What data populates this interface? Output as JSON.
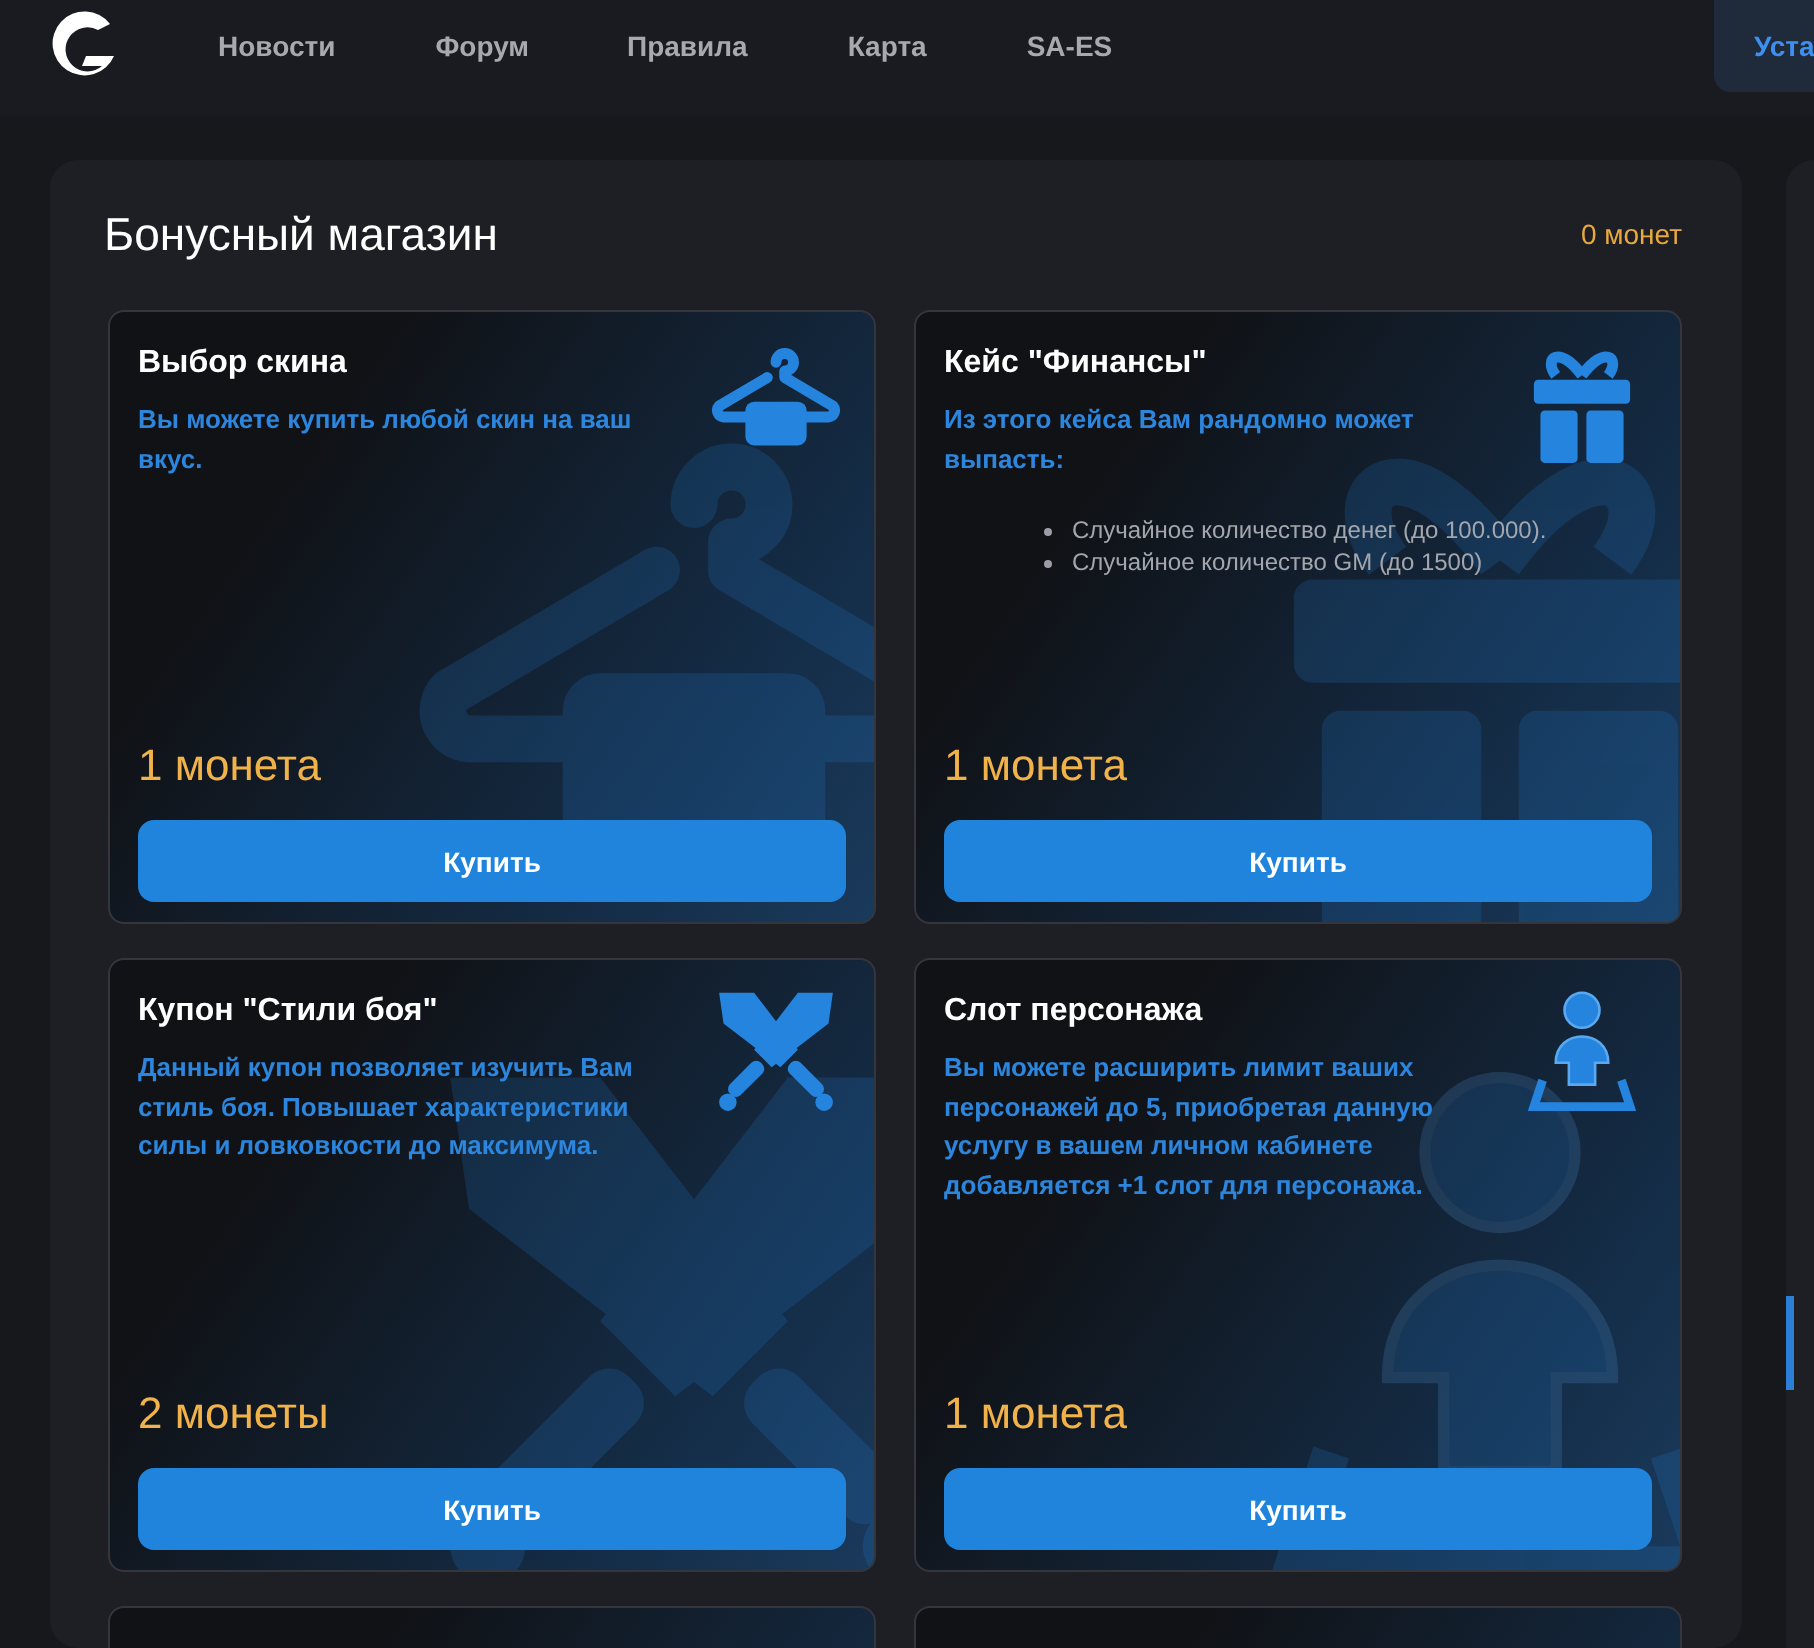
{
  "header": {
    "nav": [
      {
        "label": "Новости"
      },
      {
        "label": "Форум"
      },
      {
        "label": "Правила"
      },
      {
        "label": "Карта"
      },
      {
        "label": "SA-ES"
      }
    ],
    "action_button": "Уста"
  },
  "shop": {
    "title": "Бонусный магазин",
    "balance": "0 монет",
    "cards": [
      {
        "kind": "hanger",
        "title": "Выбор скина",
        "description": "Вы можете купить любой скин на ваш вкус.",
        "price": "1 монета",
        "button": "Купить"
      },
      {
        "kind": "gift",
        "title": "Кейс \"Финансы\"",
        "description": "Из этого кейса Вам рандомно может выпасть:",
        "bullets": [
          "Случайное количество денег (до 100.000).",
          "Случайное количество GM (до 1500)"
        ],
        "price": "1 монета",
        "button": "Купить"
      },
      {
        "kind": "swords",
        "title": "Купон \"Стили боя\"",
        "description": "Данный купон позволяет изучить Вам стиль боя. Повышает характеристики силы и ловковкости до максимума.",
        "price": "2 монеты",
        "button": "Купить"
      },
      {
        "kind": "person",
        "title": "Слот персонажа",
        "description": "Вы можете расширить лимит ваших персонажей до 5, приобретая данную услугу в вашем личном кабинете добавляется +1 слот для персонажа.",
        "price": "1 монета",
        "button": "Купить"
      },
      {
        "kind": "hanger"
      },
      {
        "kind": "gift"
      }
    ]
  }
}
